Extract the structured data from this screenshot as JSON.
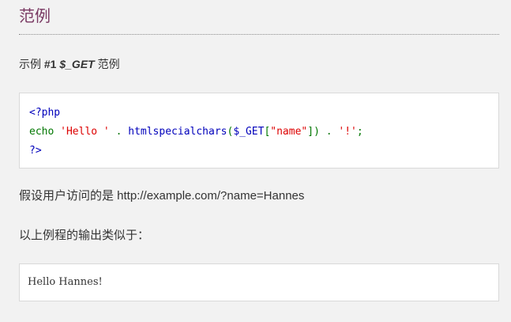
{
  "section": {
    "title": "范例"
  },
  "example": {
    "prefix": "示例 ",
    "number": "#1",
    "name": "$_GET",
    "suffix": " 范例"
  },
  "code": {
    "line1": "<?php",
    "line2_echo": "echo ",
    "line2_str1": "'Hello '",
    "line2_dot1": " . ",
    "line2_fn": "htmlspecialchars",
    "line2_paren_open": "(",
    "line2_var": "$_GET",
    "line2_bracket_open": "[",
    "line2_key": "\"name\"",
    "line2_close": "])",
    "line2_dot2": " . ",
    "line2_str2": "'!'",
    "line2_semi": ";",
    "line3": "?>"
  },
  "description": {
    "assume": "假设用户访问的是 http://example.com/?name=Hannes",
    "output_intro": "以上例程的输出类似于："
  },
  "output": {
    "text": "Hello Hannes!"
  }
}
